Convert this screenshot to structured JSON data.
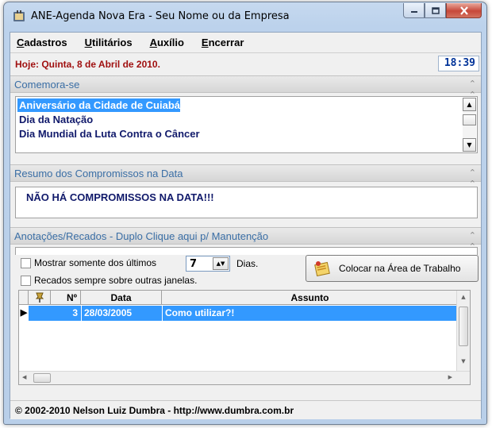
{
  "window": {
    "title": "ANE-Agenda Nova Era - Seu Nome ou da Empresa",
    "controls": [
      "minimize-icon",
      "maximize-icon",
      "close-icon"
    ]
  },
  "menu": {
    "cadastros": {
      "first": "C",
      "rest": "adastros"
    },
    "utilitarios": {
      "first": "U",
      "rest": "tilitários"
    },
    "auxilio": {
      "first": "A",
      "rest": "uxílio"
    },
    "encerrar": {
      "first": "E",
      "rest": "ncerrar"
    }
  },
  "date_bar": {
    "today": "Hoje: Quinta, 8 de Abril de 2010.",
    "time": "18:39"
  },
  "comemora": {
    "title": "Comemora-se",
    "items": [
      "Aniversário da Cidade de Cuiabá",
      "Dia da Natação",
      "Dia Mundial da Luta Contra o Câncer"
    ],
    "selected_index": 0
  },
  "resumo": {
    "title": "Resumo dos Compromissos na Data",
    "text": "NÃO HÁ COMPROMISSOS NA DATA!!!"
  },
  "anotacoes": {
    "title": "Anotações/Recados - Duplo Clique aqui p/ Manutenção",
    "show_last_label": "Mostrar somente dos últimos",
    "days_value": "7",
    "days_label": "Dias.",
    "always_on_top_label": "Recados sempre sobre outras janelas.",
    "desk_button_label": "Colocar na Área de Trabalho",
    "columns": {
      "num": "Nº",
      "date": "Data",
      "subject": "Assunto"
    },
    "rows": [
      {
        "num": "3",
        "date": "28/03/2005",
        "subject": "Como utilizar?!"
      }
    ]
  },
  "footer": {
    "text": "© 2002-2010 Nelson Luiz Dumbra - http://www.dumbra.com.br"
  },
  "colors": {
    "accent_red": "#a01010",
    "header_blue": "#3a6ea5",
    "selection": "#3399ff",
    "list_text": "#111a6b"
  }
}
